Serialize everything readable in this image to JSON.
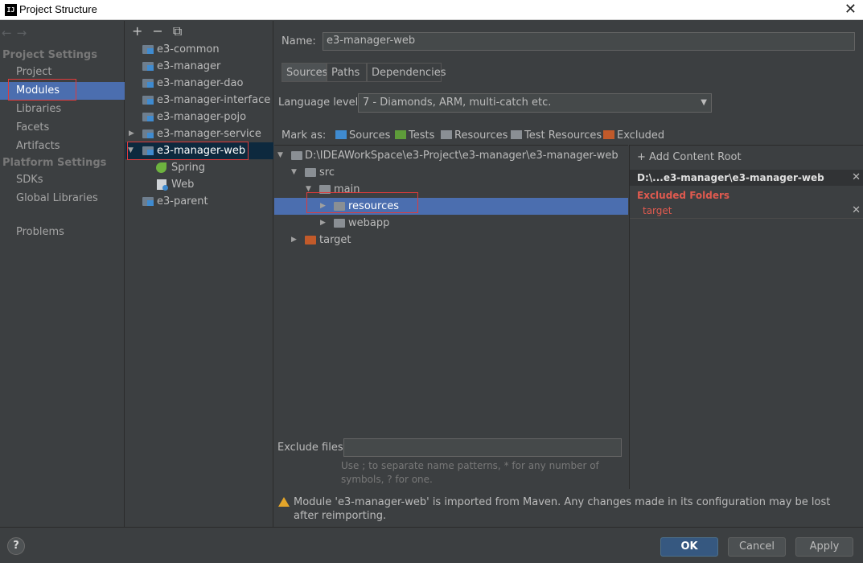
{
  "window": {
    "title": "Project Structure",
    "app_icon_text": "IJ",
    "close_glyph": "✕"
  },
  "nav": {
    "back": "←",
    "forward": "→"
  },
  "sidebar": {
    "section_project": "Project Settings",
    "project_items": [
      "Project",
      "Modules",
      "Libraries",
      "Facets",
      "Artifacts"
    ],
    "section_platform": "Platform Settings",
    "platform_items": [
      "SDKs",
      "Global Libraries"
    ],
    "problems": "Problems",
    "selected": "Modules"
  },
  "modules": {
    "toolbar": {
      "add": "+",
      "remove": "−",
      "copy": "⧉"
    },
    "items": [
      "e3-common",
      "e3-manager",
      "e3-manager-dao",
      "e3-manager-interface",
      "e3-manager-pojo",
      "e3-manager-service",
      "e3-manager-web",
      "Spring",
      "Web",
      "e3-parent"
    ],
    "selected": "e3-manager-web"
  },
  "main": {
    "name_label": "Name:",
    "name_value": "e3-manager-web",
    "tabs": [
      "Sources",
      "Paths",
      "Dependencies"
    ],
    "active_tab": "Sources",
    "language_label": "Language level:",
    "language_value": "7 - Diamonds, ARM, multi-catch etc.",
    "mark_as_label": "Mark as:",
    "mark_as": [
      {
        "label": "Sources",
        "color": "#3f8bd0"
      },
      {
        "label": "Tests",
        "color": "#5e9c3a"
      },
      {
        "label": "Resources",
        "color": "#8a8f94"
      },
      {
        "label": "Test Resources",
        "color": "#8a8f94"
      },
      {
        "label": "Excluded",
        "color": "#c25a2a"
      }
    ],
    "tree": {
      "root": "D:\\IDEAWorkSpace\\e3-Project\\e3-manager\\e3-manager-web",
      "src": "src",
      "main": "main",
      "resources": "resources",
      "webapp": "webapp",
      "target": "target"
    },
    "content_root": {
      "add_label": "+ Add Content Root",
      "path": "D:\\...e3-manager\\e3-manager-web",
      "excluded_title": "Excluded Folders",
      "excluded_items": [
        "target"
      ]
    },
    "exclude_files_label": "Exclude files:",
    "exclude_files_value": "",
    "exclude_hint": "Use ; to separate name patterns, * for any number of symbols, ? for one.",
    "warning": "Module 'e3-manager-web' is imported from Maven. Any changes made in its configuration may be lost after reimporting."
  },
  "footer": {
    "help": "?",
    "ok": "OK",
    "cancel": "Cancel",
    "apply": "Apply"
  },
  "colors": {
    "accent": "#4b6eaf",
    "highlight_box": "#e03b3b",
    "excluded_text": "#e05a4f"
  }
}
